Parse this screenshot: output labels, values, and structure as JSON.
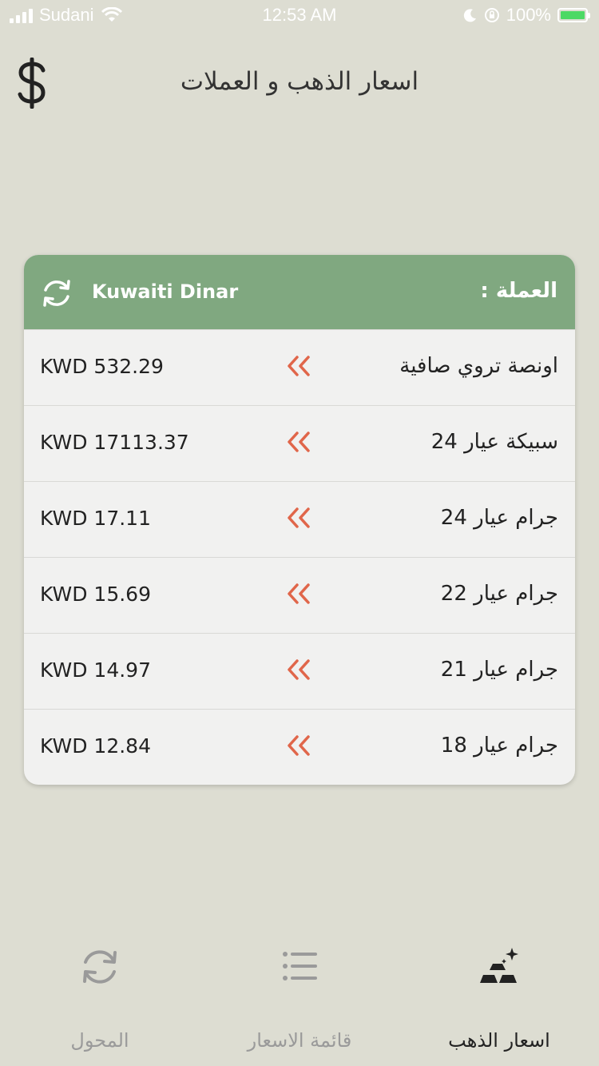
{
  "status": {
    "carrier": "Sudani",
    "time": "12:53 AM",
    "battery": "100%"
  },
  "header": {
    "title": "اسعار الذهب و العملات"
  },
  "card": {
    "currency_label": "العملة :",
    "currency_name": "Kuwaiti Dinar",
    "rows": [
      {
        "name": "اونصة تروي صافية",
        "price": "KWD 532.29"
      },
      {
        "name": "سبيكة عيار 24",
        "price": "KWD 17113.37"
      },
      {
        "name": "جرام عيار 24",
        "price": "KWD 17.11"
      },
      {
        "name": "جرام عيار 22",
        "price": "KWD 15.69"
      },
      {
        "name": "جرام عيار 21",
        "price": "KWD 14.97"
      },
      {
        "name": "جرام عيار 18",
        "price": "KWD 12.84"
      }
    ]
  },
  "tabs": {
    "converter": "المحول",
    "price_list": "قائمة الاسعار",
    "gold_prices": "اسعار الذهب"
  },
  "colors": {
    "accent": "#80a880",
    "arrow": "#e0664a",
    "background": "#ddddd2"
  }
}
